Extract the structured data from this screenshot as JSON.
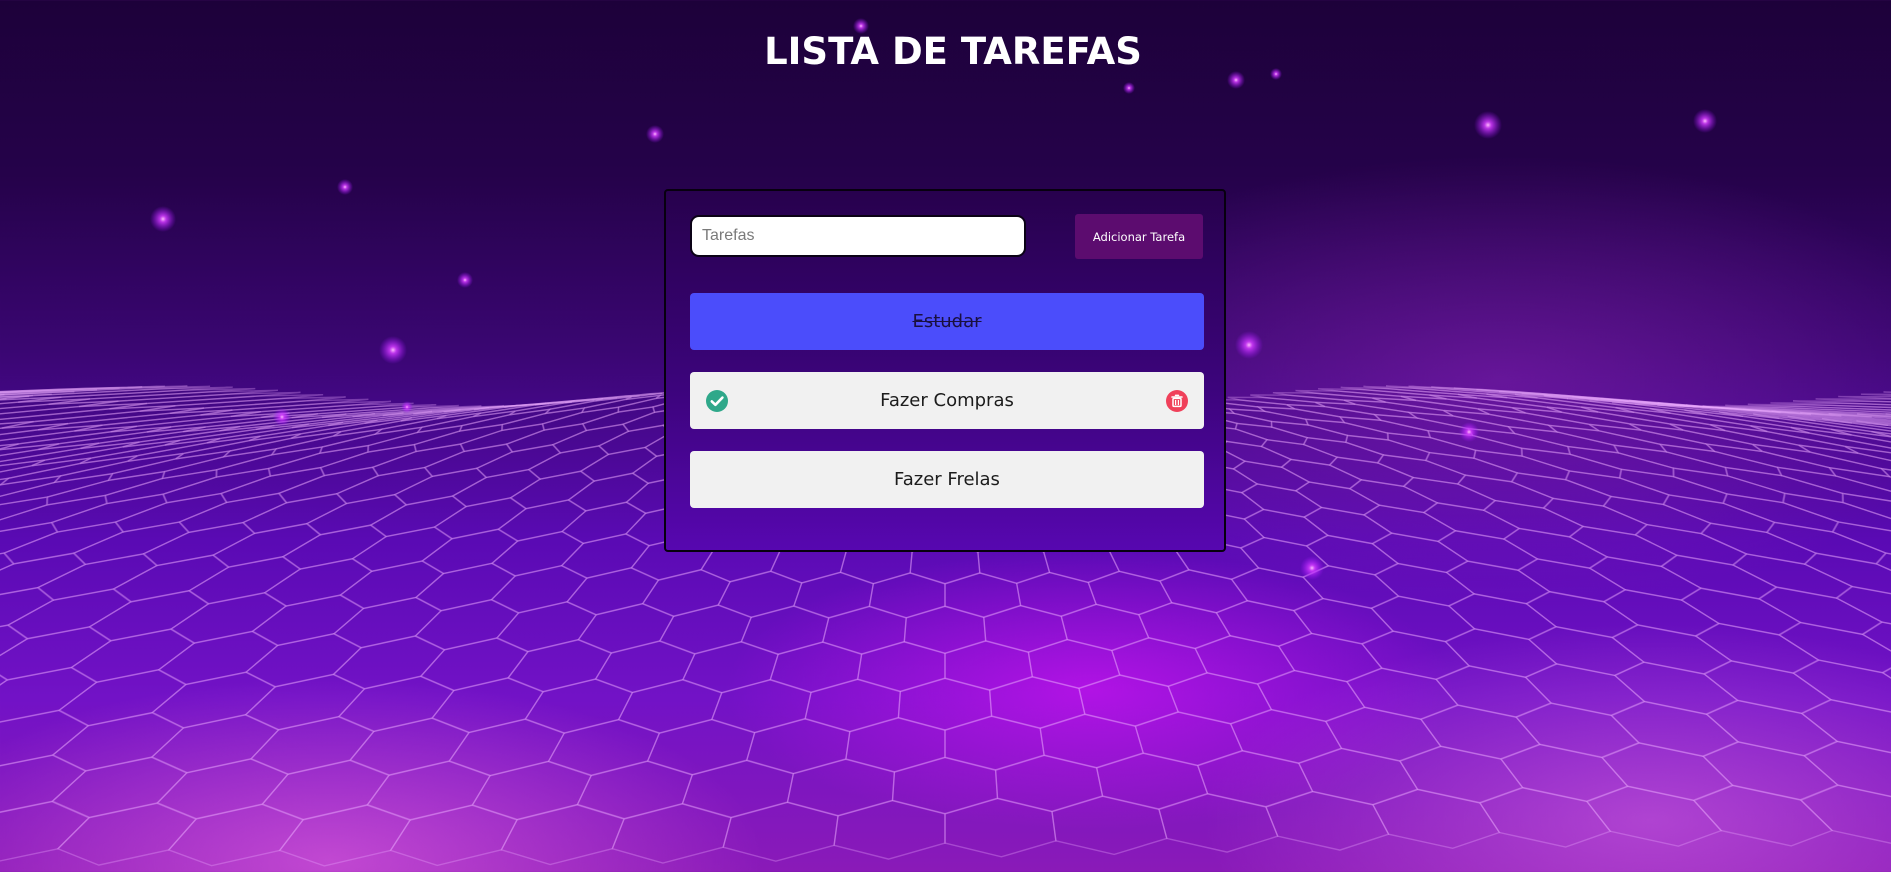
{
  "app": {
    "title": "LISTA DE TAREFAS"
  },
  "form": {
    "input_value": "",
    "input_placeholder": "Tarefas",
    "add_button_label": "Adicionar Tarefa"
  },
  "tasks": [
    {
      "label": "Estudar",
      "status": "completed",
      "color": "#4b4dfb"
    },
    {
      "label": "Fazer Compras",
      "status": "pending",
      "hover_actions": [
        "check-circle-icon",
        "trash-icon"
      ]
    },
    {
      "label": "Fazer Frelas",
      "status": "pending"
    }
  ],
  "colors": {
    "accent_button": "#5c0c6f",
    "completed_task": "#4b4dfb",
    "pending_task": "#f1f1f1",
    "check_icon": "#2fa88a",
    "trash_icon": "#f0405a"
  }
}
